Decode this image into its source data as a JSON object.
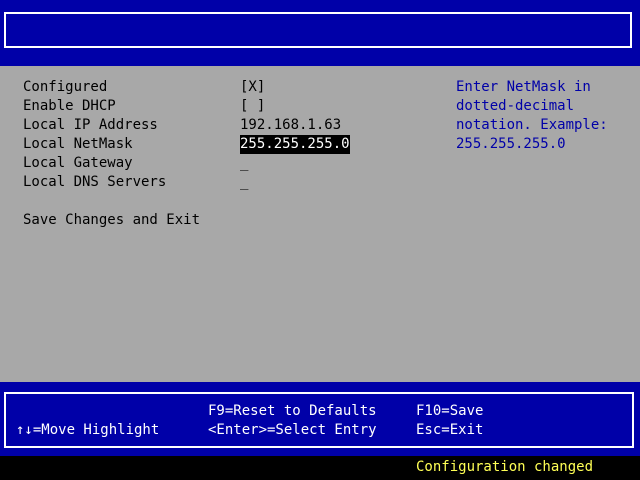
{
  "fields": [
    {
      "label": "Configured",
      "value": "[X]"
    },
    {
      "label": "Enable DHCP",
      "value": "[ ]"
    },
    {
      "label": "Local IP Address",
      "value": "192.168.1.63"
    },
    {
      "label": "Local NetMask",
      "value": "255.255.255.0"
    },
    {
      "label": "Local Gateway",
      "value": "_"
    },
    {
      "label": "Local DNS Servers",
      "value": "_"
    }
  ],
  "save_exit": "Save Changes and Exit",
  "help": [
    "Enter NetMask in",
    "dotted-decimal",
    "notation. Example:",
    "255.255.255.0"
  ],
  "footer": {
    "move_highlight": "↑↓=Move Highlight",
    "reset_defaults": "F9=Reset to Defaults",
    "select_entry": "<Enter>=Select Entry",
    "save": "F10=Save",
    "exit": "Esc=Exit"
  },
  "status": "Configuration changed",
  "colors": {
    "header_blue": "#0000a8",
    "panel_grey": "#a8a8a8",
    "help_text": "#0000a8",
    "status_text": "#ffff55"
  }
}
